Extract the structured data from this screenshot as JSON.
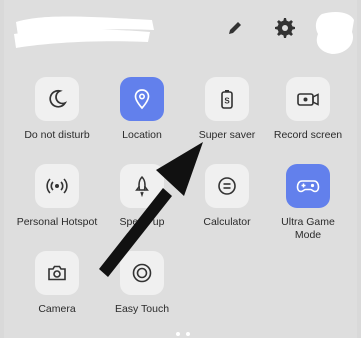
{
  "tiles": [
    {
      "label": "Do not disturb",
      "icon": "moon-icon",
      "active": false
    },
    {
      "label": "Location",
      "icon": "location-pin-icon",
      "active": true
    },
    {
      "label": "Super saver",
      "icon": "battery-saver-icon",
      "active": false
    },
    {
      "label": "Record screen",
      "icon": "screen-record-icon",
      "active": false
    },
    {
      "label": "Personal Hotspot",
      "icon": "hotspot-icon",
      "active": false
    },
    {
      "label": "Speed up",
      "icon": "rocket-icon",
      "active": false
    },
    {
      "label": "Calculator",
      "icon": "calculator-icon",
      "active": false
    },
    {
      "label": "Ultra Game Mode",
      "icon": "game-controller-icon",
      "active": true
    },
    {
      "label": "Camera",
      "icon": "camera-icon",
      "active": false
    },
    {
      "label": "Easy Touch",
      "icon": "easy-touch-icon",
      "active": false
    }
  ],
  "header": {
    "edit_icon": "pencil-icon",
    "settings_icon": "gear-icon"
  },
  "colors": {
    "active_tile": "#6280ec",
    "inactive_tile": "#f0f0f0",
    "annotation_arrow": "#111111"
  }
}
